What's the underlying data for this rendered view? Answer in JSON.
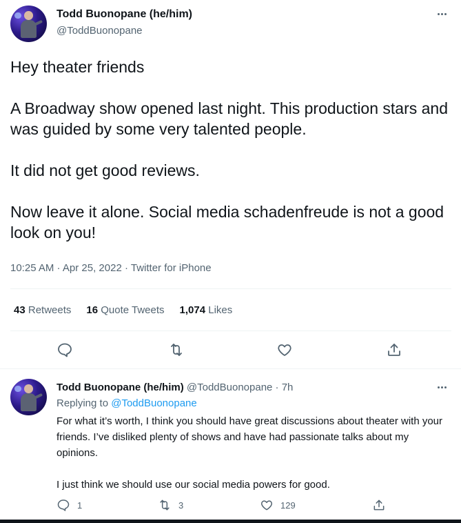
{
  "main_tweet": {
    "author_name": "Todd Buonopane (he/him)",
    "author_handle": "@ToddBuonopane",
    "text": "Hey theater friends\n\nA Broadway show opened last night. This production stars and was guided by some very talented people.\n\nIt did not get good reviews.\n\nNow leave it alone. Social media schadenfreude is not a good look on you!",
    "time": "10:25 AM",
    "date": "Apr 25, 2022",
    "source": "Twitter for iPhone",
    "meta_separator": " · ",
    "stats": {
      "retweets_count": "43",
      "retweets_label": "Retweets",
      "quotes_count": "16",
      "quotes_label": "Quote Tweets",
      "likes_count": "1,074",
      "likes_label": "Likes"
    },
    "actions": [
      "reply-icon",
      "retweet-icon",
      "like-icon",
      "share-icon"
    ]
  },
  "reply_tweet": {
    "author_name": "Todd Buonopane (he/him)",
    "author_handle": "@ToddBuonopane",
    "time_sep": " · ",
    "time": "7h",
    "replying_label": "Replying to",
    "replying_to": "@ToddBuonopane",
    "text": "For what it’s worth, I think you should have great discussions about theater with your friends. I’ve disliked plenty of shows and have had passionate talks about my opinions.\n\nI just think we should use our social media powers for good.",
    "reply_count": "1",
    "retweet_count": "3",
    "like_count": "129"
  },
  "colors": {
    "text": "#0f1419",
    "secondary": "#536471",
    "accent": "#1d9bf0",
    "border": "#eff3f4"
  }
}
